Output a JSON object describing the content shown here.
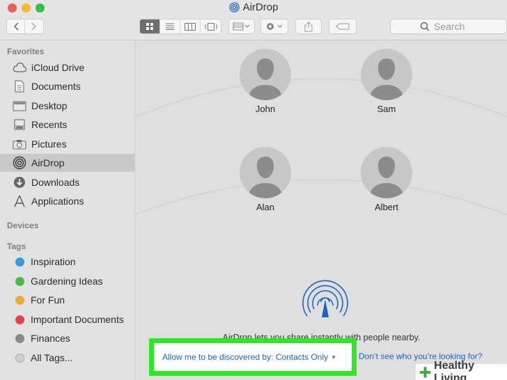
{
  "window": {
    "title": "AirDrop"
  },
  "toolbar": {
    "search_placeholder": "Search"
  },
  "sidebar": {
    "favorites_title": "Favorites",
    "favorites": [
      {
        "label": "iCloud Drive",
        "icon": "cloud-icon"
      },
      {
        "label": "Documents",
        "icon": "documents-icon"
      },
      {
        "label": "Desktop",
        "icon": "desktop-icon"
      },
      {
        "label": "Recents",
        "icon": "recents-icon"
      },
      {
        "label": "Pictures",
        "icon": "camera-icon"
      },
      {
        "label": "AirDrop",
        "icon": "airdrop-icon",
        "selected": true
      },
      {
        "label": "Downloads",
        "icon": "download-icon"
      },
      {
        "label": "Applications",
        "icon": "applications-icon"
      }
    ],
    "devices_title": "Devices",
    "tags_title": "Tags",
    "tags": [
      {
        "label": "Inspiration",
        "color": "#3a9ad9"
      },
      {
        "label": "Gardening Ideas",
        "color": "#4cb848"
      },
      {
        "label": "For Fun",
        "color": "#e9ac33"
      },
      {
        "label": "Important Documents",
        "color": "#e04545"
      },
      {
        "label": "Finances",
        "color": "#8a8a8a"
      },
      {
        "label": "All Tags...",
        "color": "#cfcfcf"
      }
    ]
  },
  "main": {
    "people": [
      {
        "name": "John"
      },
      {
        "name": "Sam"
      },
      {
        "name": "Alan"
      },
      {
        "name": "Albert"
      }
    ],
    "info_text": "AirDrop lets you share instantly with people nearby.",
    "discover_label": "Allow me to be discovered by: Contacts Only",
    "help_link": "Don’t see who you’re looking for?"
  },
  "watermark": {
    "text": "Healthy Living"
  },
  "colors": {
    "accent_link": "#1a64c8",
    "highlight_border": "#30e629",
    "airdrop_blue": "#1d63c6"
  }
}
